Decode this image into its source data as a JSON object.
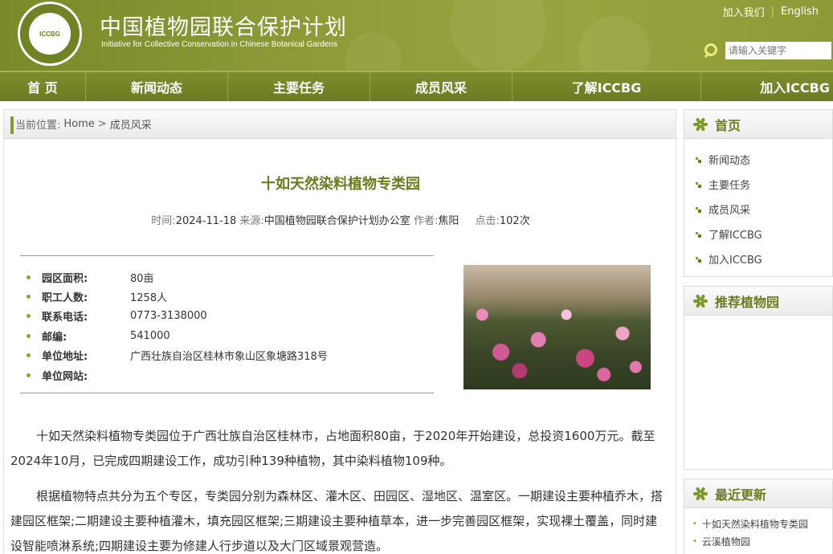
{
  "header": {
    "title": "中国植物园联合保护计划",
    "subtitle": "Initiative for Collective Conservation in Chinese Botanical Gardens",
    "logo_text": "ICCBG",
    "top_links": [
      "加入我们",
      "English"
    ],
    "search_placeholder": "请输入关键字"
  },
  "nav": {
    "items": [
      "首 页",
      "新闻动态",
      "主要任务",
      "成员风采",
      "了解ICCBG",
      "加入ICCBG"
    ]
  },
  "breadcrumb": {
    "prefix": "当前位置:",
    "home": "Home",
    "separator": ">",
    "current": "成员风采"
  },
  "article": {
    "title": "十如天然染料植物专类园",
    "time_label": "时间:",
    "time": "2024-11-18",
    "source_label": "来源:",
    "source": "中国植物园联合保护计划办公室",
    "author_label": "作者:",
    "author": "焦阳",
    "clicks_label": "点击:",
    "clicks": "102次",
    "info": [
      {
        "label": "园区面积:",
        "value": "80亩"
      },
      {
        "label": "职工人数:",
        "value": "1258人"
      },
      {
        "label": "联系电话:",
        "value": "0773-3138000"
      },
      {
        "label": "邮编:",
        "value": "541000"
      },
      {
        "label": "单位地址:",
        "value": "广西壮族自治区桂林市象山区象塘路318号"
      },
      {
        "label": "单位网站:",
        "value": ""
      }
    ],
    "paragraphs": [
      "十如天然染料植物专类园位于广西壮族自治区桂林市，占地面积80亩，于2020年开始建设，总投资1600万元。截至2024年10月，已完成四期建设工作，成功引种139种植物，其中染料植物109种。",
      "根据植物特点共分为五个专区，专类园分别为森林区、灌木区、田园区、湿地区、温室区。一期建设主要种植乔木，搭建园区框架;二期建设主要种植灌木，填充园区框架;三期建设主要种植草本，进一步完善园区框架，实现裸土覆盖，同时建设智能喷淋系统;四期建设主要为修建人行步道以及大门区域景观营造。"
    ]
  },
  "sidebar": {
    "home_title": "首页",
    "home_items": [
      "新闻动态",
      "主要任务",
      "成员风采",
      "了解ICCBG",
      "加入ICCBG"
    ],
    "recommended_title": "推荐植物园",
    "recent_title": "最近更新",
    "recent_items": [
      "十如天然染料植物专类园",
      "云溪植物园"
    ]
  },
  "colors": {
    "brand_green": "#8f9c38",
    "nav_green": "#6b7b22",
    "title_green": "#6e7b1f"
  }
}
